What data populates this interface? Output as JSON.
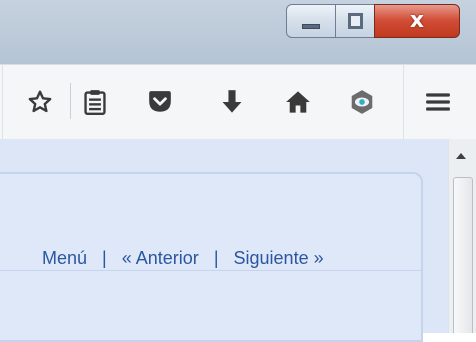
{
  "window": {
    "caption_buttons": {
      "minimize_icon": "minimize-icon",
      "maximize_icon": "restore-icon",
      "close_label": "x"
    }
  },
  "toolbar": {
    "icons": [
      "bookmark-star-icon",
      "reading-list-icon",
      "pocket-icon",
      "download-arrow-icon",
      "home-icon",
      "extension-eye-icon",
      "hamburger-menu-icon"
    ]
  },
  "nav": {
    "menu": "Menú",
    "separator": "|",
    "previous": "« Anterior",
    "next": "Siguiente »"
  },
  "colors": {
    "titlebar": "#bccad9",
    "close_button": "#d24d36",
    "toolbar": "#f4f6f8",
    "content_bg": "#dce6f7",
    "link": "#2c56a0"
  }
}
